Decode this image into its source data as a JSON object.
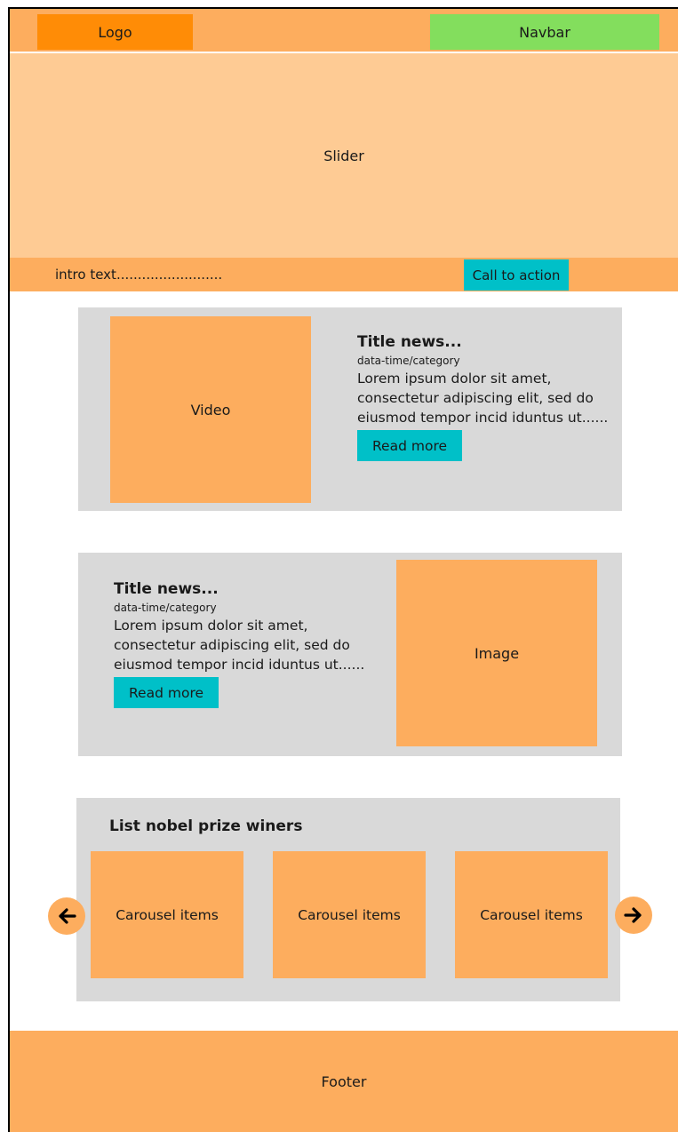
{
  "header": {
    "logo": "Logo",
    "navbar": "Navbar"
  },
  "slider": {
    "label": "Slider"
  },
  "intro": {
    "text": "intro text.........................",
    "cta": "Call to action"
  },
  "news": [
    {
      "media": "Video",
      "title": "Title news...",
      "meta": "data-time/category",
      "body": "Lorem ipsum dolor sit amet, consectetur adipiscing elit, sed do eiusmod tempor incid iduntus ut......",
      "read_more": "Read more"
    },
    {
      "media": "Image",
      "title": "Title news...",
      "meta": "data-time/category",
      "body": "Lorem ipsum dolor sit amet, consectetur adipiscing elit, sed do eiusmod tempor incid iduntus ut......",
      "read_more": "Read more"
    }
  ],
  "carousel": {
    "title": "List nobel prize winers",
    "items": [
      "Carousel items",
      "Carousel items",
      "Carousel items"
    ],
    "prev_icon": "arrow-left-icon",
    "next_icon": "arrow-right-icon"
  },
  "footer": {
    "label": "Footer"
  },
  "colors": {
    "orange": "#FDAD5E",
    "logo_orange": "#FF8C06",
    "slider_peach": "#FECB94",
    "navbar_green": "#83DE5D",
    "button_teal": "#00C0C8",
    "card_gray": "#D9D9D9"
  }
}
